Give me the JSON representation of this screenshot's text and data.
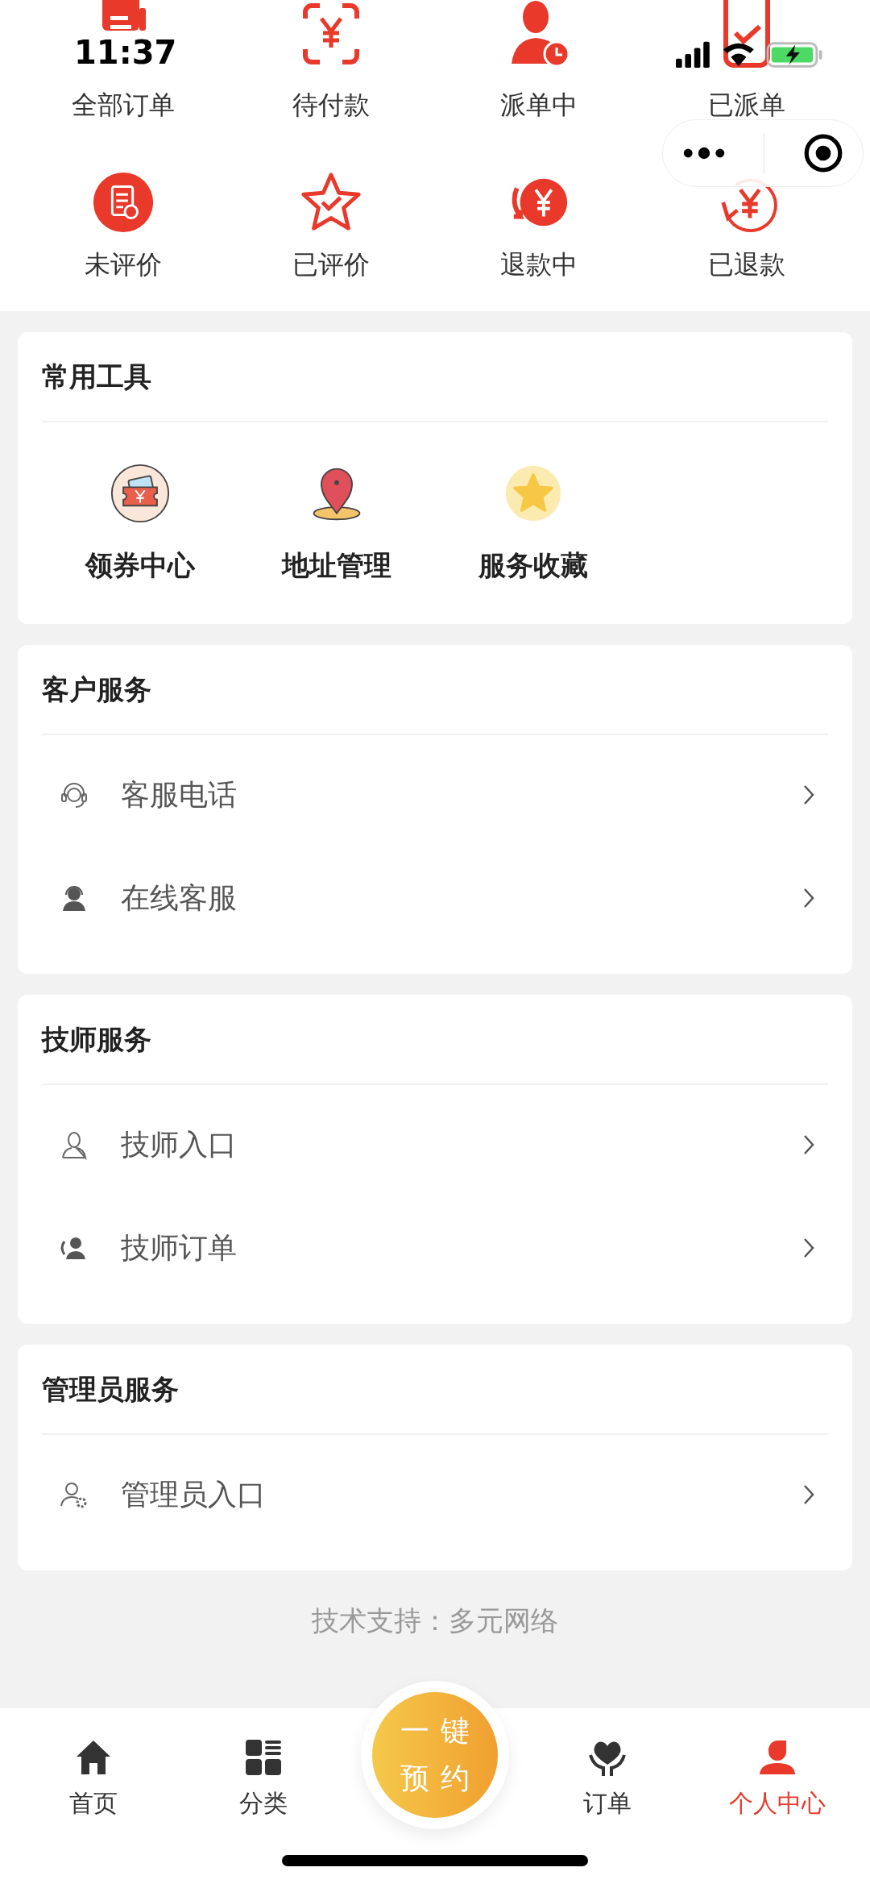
{
  "status_bar": {
    "time": "11:37"
  },
  "order_shortcuts": [
    {
      "label": "全部订单"
    },
    {
      "label": "待付款"
    },
    {
      "label": "派单中"
    },
    {
      "label": "已派单"
    },
    {
      "label": "未评价"
    },
    {
      "label": "已评价"
    },
    {
      "label": "退款中"
    },
    {
      "label": "已退款"
    }
  ],
  "sections": [
    {
      "kind": "grid",
      "title": "常用工具",
      "items": [
        {
          "label": "领券中心"
        },
        {
          "label": "地址管理"
        },
        {
          "label": "服务收藏"
        }
      ]
    },
    {
      "kind": "list",
      "title": "客户服务",
      "items": [
        {
          "label": "客服电话"
        },
        {
          "label": "在线客服"
        }
      ]
    },
    {
      "kind": "list",
      "title": "技师服务",
      "items": [
        {
          "label": "技师入口"
        },
        {
          "label": "技师订单"
        }
      ]
    },
    {
      "kind": "list",
      "title": "管理员服务",
      "items": [
        {
          "label": "管理员入口"
        }
      ]
    }
  ],
  "footer": "技术支持：多元网络",
  "tab_bar": {
    "items": [
      {
        "label": "首页",
        "selected": false
      },
      {
        "label": "分类",
        "selected": false
      },
      {
        "label": "订单",
        "selected": false
      },
      {
        "label": "个人中心",
        "selected": true
      }
    ],
    "center_button": {
      "line_1": "一键",
      "line_2": "预约"
    }
  }
}
